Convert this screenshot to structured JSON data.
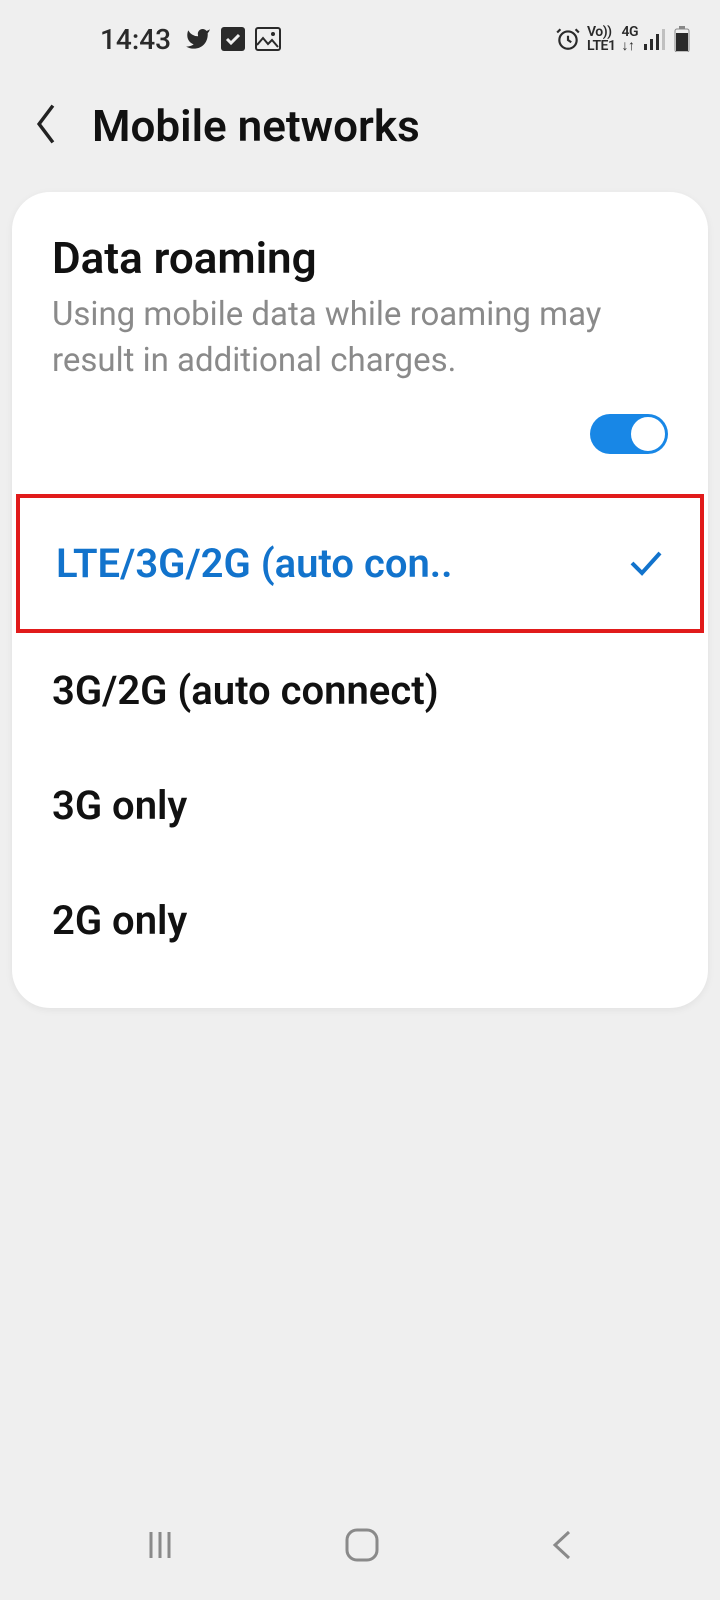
{
  "status": {
    "time": "14:43",
    "volte": "Vo))",
    "lte": "LTE1",
    "net": "4G"
  },
  "header": {
    "title": "Mobile networks"
  },
  "roaming": {
    "title": "Data roaming",
    "desc": "Using mobile data while roaming may result in additional charges.",
    "enabled": true
  },
  "network_modes": {
    "selected_index": 0,
    "options": [
      "LTE/3G/2G (auto con..",
      "3G/2G (auto connect)",
      "3G only",
      "2G only"
    ]
  }
}
